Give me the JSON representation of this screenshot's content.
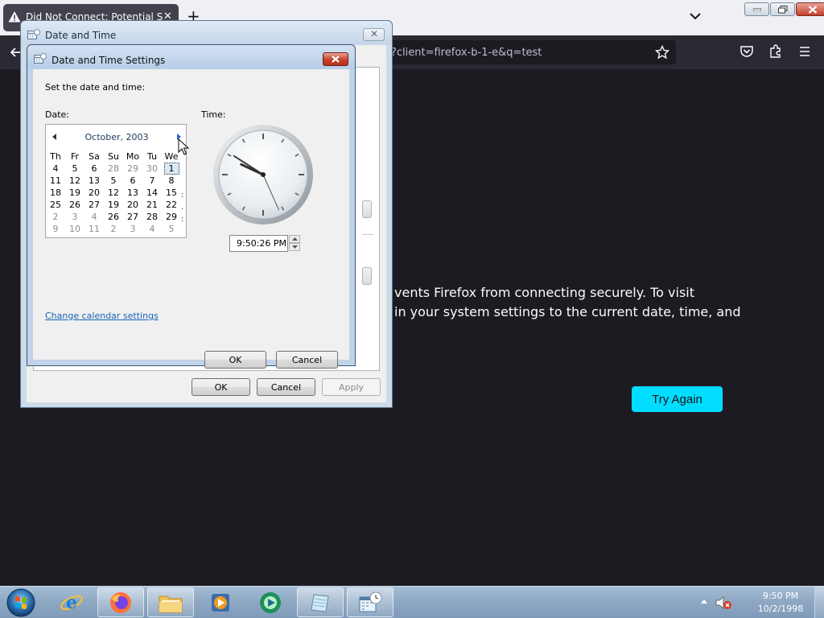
{
  "firefox": {
    "tab_title": "Did Not Connect: Potential Security Issue",
    "url_text": "?client=firefox-b-1-e&q=test",
    "error_line1": "vents Firefox from connecting securely. To visit",
    "error_line2": "in your system settings to the current date, time, and",
    "try_again_label": "Try Again",
    "accent": "#00ddff"
  },
  "date_time_dialog": {
    "title": "Date and Time",
    "ok_label": "OK",
    "cancel_label": "Cancel",
    "apply_label": "Apply"
  },
  "settings_dialog": {
    "title": "Date and Time Settings",
    "instruction": "Set the date and time:",
    "date_label": "Date:",
    "time_label": "Time:",
    "calendar": {
      "month": "October, 2003",
      "weekdays": [
        "Th",
        "Fr",
        "Sa",
        "Su",
        "Mo",
        "Tu",
        "We"
      ],
      "weeks": [
        [
          {
            "d": "4",
            "c": "cur"
          },
          {
            "d": "5",
            "c": "cur"
          },
          {
            "d": "6",
            "c": "cur"
          },
          {
            "d": "28",
            "c": "oth"
          },
          {
            "d": "29",
            "c": "oth"
          },
          {
            "d": "30",
            "c": "oth"
          },
          {
            "d": "1",
            "c": "sel"
          }
        ],
        [
          {
            "d": "11",
            "c": "cur"
          },
          {
            "d": "12",
            "c": "cur"
          },
          {
            "d": "13",
            "c": "cur"
          },
          {
            "d": "5",
            "c": "cur"
          },
          {
            "d": "6",
            "c": "cur"
          },
          {
            "d": "7",
            "c": "cur"
          },
          {
            "d": "8",
            "c": "cur"
          }
        ],
        [
          {
            "d": "18",
            "c": "cur"
          },
          {
            "d": "19",
            "c": "cur"
          },
          {
            "d": "20",
            "c": "cur"
          },
          {
            "d": "12",
            "c": "cur"
          },
          {
            "d": "13",
            "c": "cur"
          },
          {
            "d": "14",
            "c": "cur"
          },
          {
            "d": "15",
            "c": "cur"
          }
        ],
        [
          {
            "d": "25",
            "c": "cur"
          },
          {
            "d": "26",
            "c": "cur"
          },
          {
            "d": "27",
            "c": "cur"
          },
          {
            "d": "19",
            "c": "cur"
          },
          {
            "d": "20",
            "c": "cur"
          },
          {
            "d": "21",
            "c": "cur"
          },
          {
            "d": "22",
            "c": "cur"
          }
        ],
        [
          {
            "d": "2",
            "c": "oth"
          },
          {
            "d": "3",
            "c": "oth"
          },
          {
            "d": "4",
            "c": "oth"
          },
          {
            "d": "26",
            "c": "cur"
          },
          {
            "d": "27",
            "c": "cur"
          },
          {
            "d": "28",
            "c": "cur"
          },
          {
            "d": "29",
            "c": "cur"
          }
        ],
        [
          {
            "d": "9",
            "c": "oth"
          },
          {
            "d": "10",
            "c": "oth"
          },
          {
            "d": "11",
            "c": "oth"
          },
          {
            "d": "2",
            "c": "oth"
          },
          {
            "d": "3",
            "c": "oth"
          },
          {
            "d": "4",
            "c": "oth"
          },
          {
            "d": "5",
            "c": "oth"
          }
        ]
      ]
    },
    "clock": {
      "hours": 9,
      "minutes": 50,
      "seconds": 26
    },
    "time_value": "9:50:26 PM",
    "change_calendar_link": "Change calendar settings",
    "ok_label": "OK",
    "cancel_label": "Cancel"
  },
  "taskbar": {
    "apps": [
      "internet-explorer",
      "firefox",
      "windows-explorer",
      "media-player",
      "media-center",
      "notepad",
      "date-time-control-panel"
    ],
    "clock_time": "9:50 PM",
    "clock_date": "10/2/1998"
  }
}
